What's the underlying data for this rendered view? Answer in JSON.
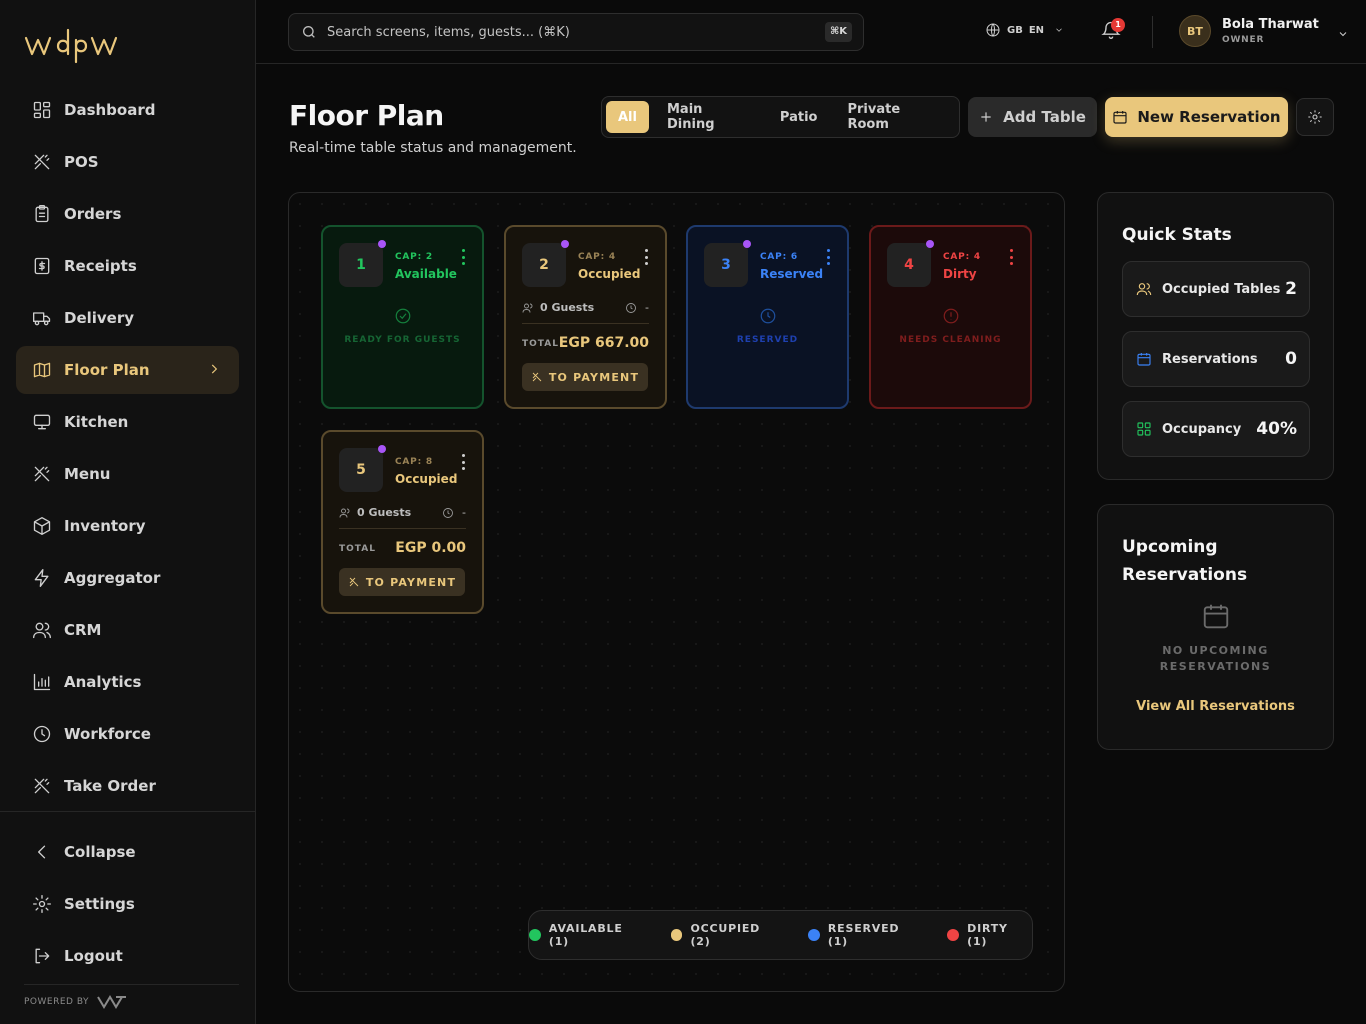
{
  "brand": {
    "logo_text": "wdpw",
    "powered_by": "POWERED BY"
  },
  "sidebar": {
    "items": [
      {
        "label": "Dashboard",
        "icon": "dashboard-icon"
      },
      {
        "label": "POS",
        "icon": "utensils-icon"
      },
      {
        "label": "Orders",
        "icon": "clipboard-icon"
      },
      {
        "label": "Receipts",
        "icon": "receipt-icon"
      },
      {
        "label": "Delivery",
        "icon": "truck-icon"
      },
      {
        "label": "Floor Plan",
        "icon": "map-icon",
        "active": true
      },
      {
        "label": "Kitchen",
        "icon": "monitor-icon"
      },
      {
        "label": "Menu",
        "icon": "utensils-icon"
      },
      {
        "label": "Inventory",
        "icon": "box-icon"
      },
      {
        "label": "Aggregator",
        "icon": "zap-icon"
      },
      {
        "label": "CRM",
        "icon": "users-icon"
      },
      {
        "label": "Analytics",
        "icon": "bar-chart-icon"
      },
      {
        "label": "Workforce",
        "icon": "clock-icon"
      },
      {
        "label": "Take Order",
        "icon": "utensils-icon"
      }
    ],
    "bottom": [
      {
        "label": "Collapse",
        "icon": "chevron-left-icon"
      },
      {
        "label": "Settings",
        "icon": "gear-icon"
      },
      {
        "label": "Logout",
        "icon": "logout-icon"
      }
    ]
  },
  "topbar": {
    "search_placeholder": "Search screens, items, guests... (⌘K)",
    "search_kbd": "⌘K",
    "lang_flag": "GB",
    "lang_code": "EN",
    "notifications": "1",
    "user": {
      "initials": "BT",
      "name": "Bola Tharwat",
      "role": "OWNER"
    }
  },
  "page": {
    "title": "Floor Plan",
    "subtitle": "Real-time table status and management.",
    "filters": [
      "All",
      "Main Dining",
      "Patio",
      "Private Room"
    ],
    "active_filter": "All",
    "add_table": "Add Table",
    "new_reservation": "New Reservation"
  },
  "tables": [
    {
      "number": "1",
      "capacity": "CAP: 2",
      "status": "Available",
      "state": "available",
      "center_label": "READY FOR GUESTS"
    },
    {
      "number": "2",
      "capacity": "CAP: 4",
      "status": "Occupied",
      "state": "occupied",
      "guests": "0 Guests",
      "time": "-",
      "total_label": "TOTAL",
      "total": "EGP 667.00",
      "pay_label": "TO PAYMENT"
    },
    {
      "number": "3",
      "capacity": "CAP: 6",
      "status": "Reserved",
      "state": "reserved",
      "center_label": "RESERVED"
    },
    {
      "number": "4",
      "capacity": "CAP: 4",
      "status": "Dirty",
      "state": "dirty",
      "center_label": "NEEDS CLEANING"
    },
    {
      "number": "5",
      "capacity": "CAP: 8",
      "status": "Occupied",
      "state": "occupied",
      "guests": "0 Guests",
      "time": "-",
      "total_label": "TOTAL",
      "total": "EGP 0.00",
      "pay_label": "TO PAYMENT"
    }
  ],
  "legend": [
    {
      "label": "AVAILABLE (1)",
      "color": "#22c55e"
    },
    {
      "label": "OCCUPIED (2)",
      "color": "#e9c77c"
    },
    {
      "label": "RESERVED (1)",
      "color": "#3b82f6"
    },
    {
      "label": "DIRTY (1)",
      "color": "#ef4444"
    }
  ],
  "quick_stats": {
    "title": "Quick Stats",
    "items": [
      {
        "label": "Occupied Tables",
        "value": "2",
        "icon": "users-icon",
        "color": "#e9c77c"
      },
      {
        "label": "Reservations",
        "value": "0",
        "icon": "calendar-icon",
        "color": "#3b82f6"
      },
      {
        "label": "Occupancy",
        "value": "40%",
        "icon": "grid-icon",
        "color": "#22c55e"
      }
    ]
  },
  "upcoming": {
    "title_line1": "Upcoming",
    "title_line2": "Reservations",
    "empty_line1": "NO UPCOMING",
    "empty_line2": "RESERVATIONS",
    "view_all": "View All Reservations"
  },
  "colors": {
    "accent": "#e9c77c",
    "available": "#22c55e",
    "reserved": "#3b82f6",
    "dirty": "#ef4444",
    "indicator": "#a855f7"
  }
}
